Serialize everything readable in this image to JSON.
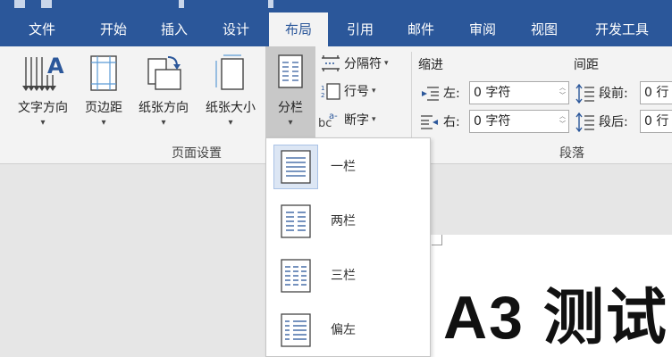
{
  "title": {
    "partial_text": "开发工具"
  },
  "tabs": [
    {
      "label": "文件",
      "active": false
    },
    {
      "label": "开始",
      "active": false
    },
    {
      "label": "插入",
      "active": false
    },
    {
      "label": "设计",
      "active": false
    },
    {
      "label": "布局",
      "active": true
    },
    {
      "label": "引用",
      "active": false
    },
    {
      "label": "邮件",
      "active": false
    },
    {
      "label": "审阅",
      "active": false
    },
    {
      "label": "视图",
      "active": false
    },
    {
      "label": "开发工具",
      "active": false
    }
  ],
  "page_setup": {
    "group_label": "页面设置",
    "text_direction": "文字方向",
    "margins": "页边距",
    "orientation": "纸张方向",
    "size": "纸张大小",
    "columns": "分栏",
    "breaks": "分隔符",
    "line_numbers": "行号",
    "hyphenation": "断字"
  },
  "paragraph": {
    "group_label": "段落",
    "indent_label": "缩进",
    "spacing_label": "间距",
    "left_label": "左:",
    "left_value": "0 字符",
    "right_label": "右:",
    "right_value": "0 字符",
    "before_label": "段前:",
    "before_value": "0 行",
    "after_label": "段后:",
    "after_value": "0 行"
  },
  "columns_menu": {
    "items": [
      {
        "label": "一栏",
        "icon": "one-column-icon",
        "hover": true
      },
      {
        "label": "两栏",
        "icon": "two-columns-icon",
        "hover": false
      },
      {
        "label": "三栏",
        "icon": "three-columns-icon",
        "hover": false
      },
      {
        "label": "偏左",
        "icon": "left-column-icon",
        "hover": false
      }
    ]
  },
  "document": {
    "text": "A3 测试"
  },
  "colors": {
    "accent": "#2b579a",
    "ribbon": "#f3f3f3",
    "pressed": "#c8c8c8",
    "hover": "#dce6f4"
  }
}
